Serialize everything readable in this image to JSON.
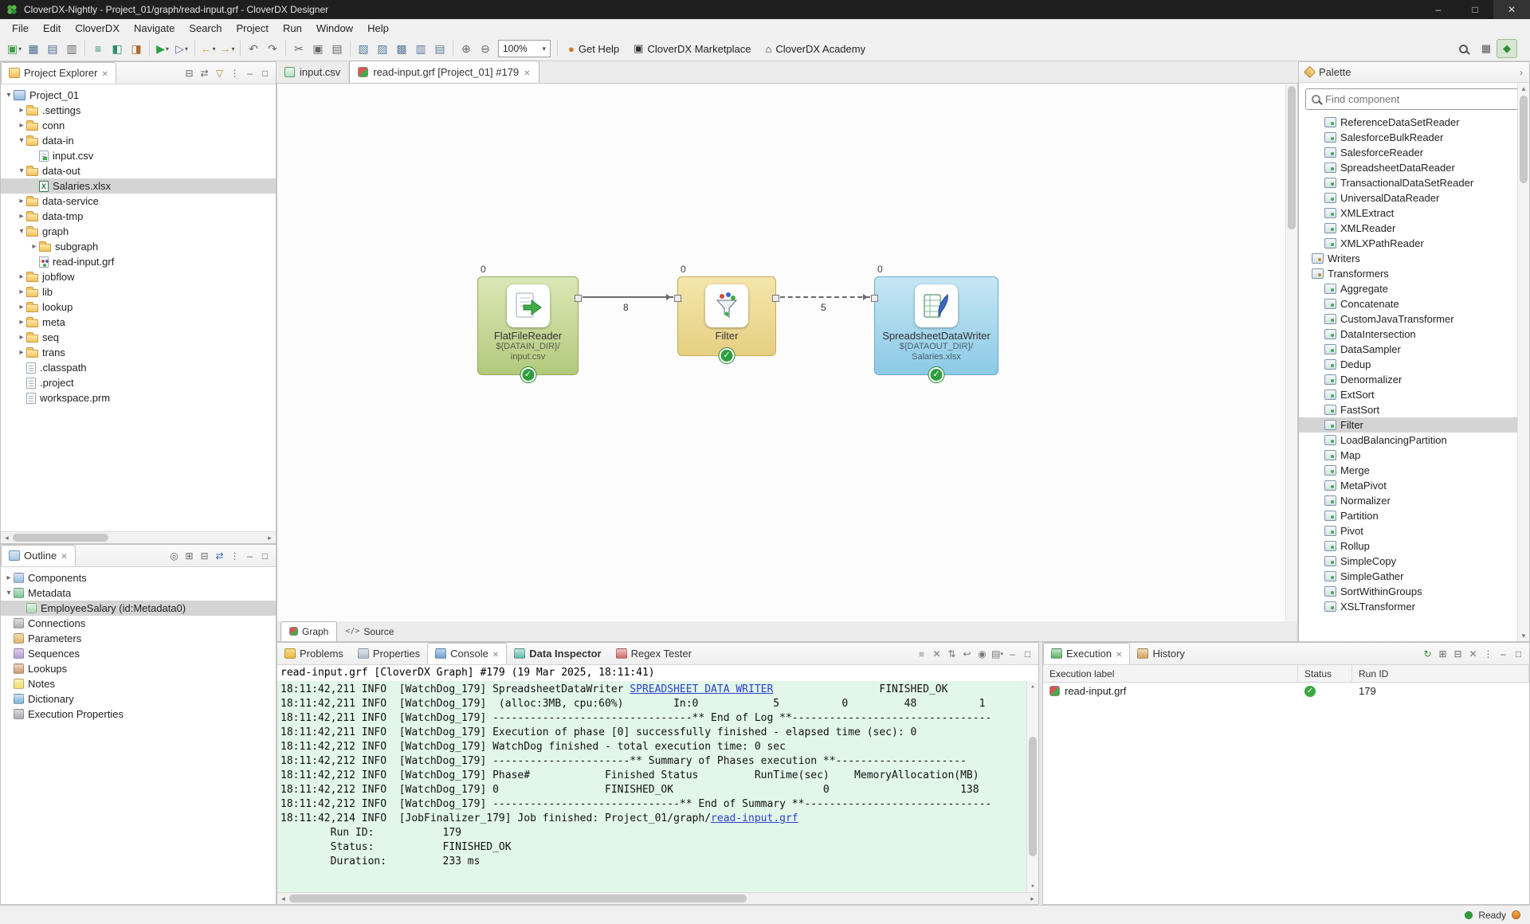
{
  "icons": {
    "close": "✕",
    "check": "✓",
    "win_min": "–",
    "win_max": "□",
    "win_close": "✕",
    "arrow_left": "◂",
    "arrow_right": "▸",
    "arrow_up": "▴",
    "arrow_down": "▾",
    "dropdown": "▾",
    "chevron_right": "›",
    "source": "</>"
  },
  "titlebar": {
    "title": "CloverDX-Nightly - Project_01/graph/read-input.grf - CloverDX Designer",
    "controls": [
      {
        "name": "minimize-window-button",
        "glyph": "–"
      },
      {
        "name": "maximize-window-button",
        "glyph": "□"
      },
      {
        "name": "close-window-button",
        "glyph": "✕"
      }
    ]
  },
  "menubar": {
    "items": [
      "File",
      "Edit",
      "CloverDX",
      "Navigate",
      "Search",
      "Project",
      "Run",
      "Window",
      "Help"
    ]
  },
  "toolbar": {
    "zoom_value": "100%",
    "icons": [
      {
        "name": "new-graph-button",
        "glyph": "▣",
        "color": "#3f9d4c",
        "dd": true
      },
      {
        "name": "save-button",
        "glyph": "▦",
        "color": "#4a6c8f"
      },
      {
        "name": "save-all-button",
        "glyph": "▤",
        "color": "#4a6c8f"
      },
      {
        "name": "print-button",
        "glyph": "▥",
        "color": "#666666"
      },
      {
        "sep": true
      },
      {
        "name": "metadata-button",
        "glyph": "≡",
        "color": "#2e8f6e"
      },
      {
        "name": "database-button",
        "glyph": "◧",
        "color": "#2e8f6e"
      },
      {
        "name": "connection-button",
        "glyph": "◨",
        "color": "#b06a2c"
      },
      {
        "sep": true
      },
      {
        "name": "run-graph-button",
        "glyph": "▶",
        "color": "#2ea043",
        "dd": true
      },
      {
        "name": "debug-graph-button",
        "glyph": "▷",
        "color": "#7a5ea8",
        "dd": true
      },
      {
        "sep": true
      },
      {
        "name": "back-button",
        "glyph": "←",
        "color": "#caa53d",
        "dd": true
      },
      {
        "name": "forward-button",
        "glyph": "→",
        "color": "#caa53d",
        "dd": true
      },
      {
        "sep": true
      },
      {
        "name": "undo-button",
        "glyph": "↶",
        "color": "#666666"
      },
      {
        "name": "redo-button",
        "glyph": "↷",
        "color": "#666666"
      },
      {
        "sep": true
      },
      {
        "name": "cut-button",
        "glyph": "✂",
        "color": "#666666"
      },
      {
        "name": "copy-button",
        "glyph": "▣",
        "color": "#666666"
      },
      {
        "name": "paste-button",
        "glyph": "▤",
        "color": "#666666"
      },
      {
        "sep": true
      },
      {
        "name": "align-left-button",
        "glyph": "▧",
        "color": "#5a7d9a"
      },
      {
        "name": "align-center-button",
        "glyph": "▨",
        "color": "#5a7d9a"
      },
      {
        "name": "align-right-button",
        "glyph": "▩",
        "color": "#5a7d9a"
      },
      {
        "name": "distribute-horizontal-button",
        "glyph": "▥",
        "color": "#5a7d9a"
      },
      {
        "name": "distribute-vertical-button",
        "glyph": "▤",
        "color": "#5a7d9a"
      },
      {
        "sep": true
      },
      {
        "name": "zoom-in-button",
        "glyph": "⊕",
        "color": "#666666"
      },
      {
        "name": "zoom-out-button",
        "glyph": "⊖",
        "color": "#666666"
      }
    ],
    "links": [
      {
        "name": "get-help-button",
        "label": "Get Help",
        "glyph": "●",
        "color": "#d9772a"
      },
      {
        "name": "marketplace-button",
        "label": "CloverDX Marketplace",
        "glyph": "▣",
        "color": "#333333"
      },
      {
        "name": "academy-button",
        "label": "CloverDX Academy",
        "glyph": "⌂",
        "color": "#333333"
      }
    ],
    "right_icons": [
      {
        "name": "open-perspective-icon",
        "glyph": "▦",
        "color": "#555555"
      },
      {
        "name": "cloverdx-perspective-icon",
        "glyph": "◆",
        "color": "#2e8f3a",
        "active": true
      }
    ]
  },
  "explorer": {
    "tab": "Project Explorer",
    "actions": [
      {
        "name": "collapse-all-icon",
        "glyph": "⊟",
        "color": "#666666"
      },
      {
        "name": "link-with-editor-icon",
        "glyph": "⇄",
        "color": "#666666"
      },
      {
        "name": "filter-tree-icon",
        "glyph": "▽",
        "color": "#a8862f"
      },
      {
        "name": "view-menu-icon",
        "glyph": "⋮",
        "color": "#666666"
      },
      {
        "name": "minimize-view-icon",
        "glyph": "–",
        "color": "#666666"
      },
      {
        "name": "maximize-view-icon",
        "glyph": "□",
        "color": "#666666"
      }
    ],
    "items": [
      {
        "label": "Project_01",
        "depth": 0,
        "icon": "project",
        "expander": "expanded"
      },
      {
        "label": ".settings",
        "depth": 1,
        "icon": "folder",
        "expander": "collapsed"
      },
      {
        "label": "conn",
        "depth": 1,
        "icon": "folder",
        "expander": "collapsed"
      },
      {
        "label": "data-in",
        "depth": 1,
        "icon": "folder",
        "expander": "expanded"
      },
      {
        "label": "input.csv",
        "depth": 2,
        "icon": "csv"
      },
      {
        "label": "data-out",
        "depth": 1,
        "icon": "folder",
        "expander": "expanded"
      },
      {
        "label": "Salaries.xlsx",
        "depth": 2,
        "icon": "excel",
        "selected": true
      },
      {
        "label": "data-service",
        "depth": 1,
        "icon": "folder",
        "expander": "collapsed"
      },
      {
        "label": "data-tmp",
        "depth": 1,
        "icon": "folder",
        "expander": "collapsed"
      },
      {
        "label": "graph",
        "depth": 1,
        "icon": "folder",
        "expander": "expanded"
      },
      {
        "label": "subgraph",
        "depth": 2,
        "icon": "folder",
        "expander": "collapsed"
      },
      {
        "label": "read-input.grf",
        "depth": 2,
        "icon": "graph"
      },
      {
        "label": "jobflow",
        "depth": 1,
        "icon": "folder",
        "expander": "collapsed"
      },
      {
        "label": "lib",
        "depth": 1,
        "icon": "folder",
        "expander": "collapsed"
      },
      {
        "label": "lookup",
        "depth": 1,
        "icon": "folder",
        "expander": "collapsed"
      },
      {
        "label": "meta",
        "depth": 1,
        "icon": "folder",
        "expander": "collapsed"
      },
      {
        "label": "seq",
        "depth": 1,
        "icon": "folder",
        "expander": "collapsed"
      },
      {
        "label": "trans",
        "depth": 1,
        "icon": "folder",
        "expander": "collapsed"
      },
      {
        "label": ".classpath",
        "depth": 1,
        "icon": "file"
      },
      {
        "label": ".project",
        "depth": 1,
        "icon": "file"
      },
      {
        "label": "workspace.prm",
        "depth": 1,
        "icon": "file"
      }
    ]
  },
  "outline": {
    "tab": "Outline",
    "actions": [
      {
        "name": "focus-icon",
        "glyph": "◎",
        "color": "#666666"
      },
      {
        "name": "expand-all-icon",
        "glyph": "⊞",
        "color": "#666666"
      },
      {
        "name": "collapse-all-icon",
        "glyph": "⊟",
        "color": "#666666"
      },
      {
        "name": "link-with-editor-icon",
        "glyph": "⇄",
        "color": "#2f6fb0"
      },
      {
        "name": "view-menu-icon",
        "glyph": "⋮",
        "color": "#666666"
      },
      {
        "name": "minimize-view-icon",
        "glyph": "–",
        "color": "#666666"
      },
      {
        "name": "maximize-view-icon",
        "glyph": "□",
        "color": "#666666"
      }
    ],
    "items": [
      {
        "label": "Components",
        "depth": 0,
        "icon": "components",
        "expander": "collapsed"
      },
      {
        "label": "Metadata",
        "depth": 0,
        "icon": "metadata",
        "expander": "expanded"
      },
      {
        "label": "EmployeeSalary (id:Metadata0)",
        "depth": 1,
        "icon": "record",
        "selected": true
      },
      {
        "label": "Connections",
        "depth": 0,
        "icon": "connections"
      },
      {
        "label": "Parameters",
        "depth": 0,
        "icon": "parameters"
      },
      {
        "label": "Sequences",
        "depth": 0,
        "icon": "sequences"
      },
      {
        "label": "Lookups",
        "depth": 0,
        "icon": "lookups"
      },
      {
        "label": "Notes",
        "depth": 0,
        "icon": "notes"
      },
      {
        "label": "Dictionary",
        "depth": 0,
        "icon": "dictionary"
      },
      {
        "label": "Execution Properties",
        "depth": 0,
        "icon": "execprops"
      }
    ]
  },
  "editor": {
    "tabs": [
      {
        "label": "input.csv"
      },
      {
        "label": "read-input.grf [Project_01] #179"
      }
    ],
    "bottom_tabs": [
      "Graph",
      "Source"
    ]
  },
  "canvas": {
    "nodes": [
      {
        "label": "FlatFileReader",
        "sub1": "${DATAIN_DIR}/",
        "sub2": "input.csv",
        "phase": "0"
      },
      {
        "label": "Filter",
        "sub1": "",
        "sub2": "",
        "phase": "0"
      },
      {
        "label": "SpreadsheetDataWriter",
        "sub1": "${DATAOUT_DIR}/",
        "sub2": "Salaries.xlsx",
        "phase": "0"
      }
    ],
    "edges": [
      {
        "count": "8"
      },
      {
        "count": "5"
      }
    ]
  },
  "palette": {
    "title": "Palette",
    "search_placeholder": "Find component",
    "items": [
      {
        "label": "ReferenceDataSetReader",
        "depth": 1,
        "type": "component"
      },
      {
        "label": "SalesforceBulkReader",
        "depth": 1,
        "type": "component"
      },
      {
        "label": "SalesforceReader",
        "depth": 1,
        "type": "component"
      },
      {
        "label": "SpreadsheetDataReader",
        "depth": 1,
        "type": "component"
      },
      {
        "label": "TransactionalDataSetReader",
        "depth": 1,
        "type": "component"
      },
      {
        "label": "UniversalDataReader",
        "depth": 1,
        "type": "component"
      },
      {
        "label": "XMLExtract",
        "depth": 1,
        "type": "component"
      },
      {
        "label": "XMLReader",
        "depth": 1,
        "type": "component"
      },
      {
        "label": "XMLXPathReader",
        "depth": 1,
        "type": "component"
      },
      {
        "label": "Writers",
        "depth": 0,
        "type": "category",
        "expander": "collapsed"
      },
      {
        "label": "Transformers",
        "depth": 0,
        "type": "category",
        "expander": "expanded"
      },
      {
        "label": "Aggregate",
        "depth": 1,
        "type": "component"
      },
      {
        "label": "Concatenate",
        "depth": 1,
        "type": "component"
      },
      {
        "label": "CustomJavaTransformer",
        "depth": 1,
        "type": "component"
      },
      {
        "label": "DataIntersection",
        "depth": 1,
        "type": "component"
      },
      {
        "label": "DataSampler",
        "depth": 1,
        "type": "component"
      },
      {
        "label": "Dedup",
        "depth": 1,
        "type": "component"
      },
      {
        "label": "Denormalizer",
        "depth": 1,
        "type": "component"
      },
      {
        "label": "ExtSort",
        "depth": 1,
        "type": "component"
      },
      {
        "label": "FastSort",
        "depth": 1,
        "type": "component"
      },
      {
        "label": "Filter",
        "depth": 1,
        "type": "component",
        "selected": true
      },
      {
        "label": "LoadBalancingPartition",
        "depth": 1,
        "type": "component"
      },
      {
        "label": "Map",
        "depth": 1,
        "type": "component"
      },
      {
        "label": "Merge",
        "depth": 1,
        "type": "component"
      },
      {
        "label": "MetaPivot",
        "depth": 1,
        "type": "component"
      },
      {
        "label": "Normalizer",
        "depth": 1,
        "type": "component"
      },
      {
        "label": "Partition",
        "depth": 1,
        "type": "component"
      },
      {
        "label": "Pivot",
        "depth": 1,
        "type": "component"
      },
      {
        "label": "Rollup",
        "depth": 1,
        "type": "component"
      },
      {
        "label": "SimpleCopy",
        "depth": 1,
        "type": "component"
      },
      {
        "label": "SimpleGather",
        "depth": 1,
        "type": "component"
      },
      {
        "label": "SortWithinGroups",
        "depth": 1,
        "type": "component"
      },
      {
        "label": "XSLTransformer",
        "depth": 1,
        "type": "component"
      }
    ]
  },
  "console": {
    "tabs": [
      {
        "name": "tab-problems",
        "label": "Problems",
        "icon": "problems"
      },
      {
        "name": "tab-properties",
        "label": "Properties",
        "icon": "properties"
      },
      {
        "name": "tab-console",
        "label": "Console",
        "icon": "console",
        "active": true,
        "closable": true
      },
      {
        "name": "tab-data-inspector",
        "label": "Data Inspector",
        "icon": "inspector",
        "bold": true
      },
      {
        "name": "tab-regex-tester",
        "label": "Regex Tester",
        "icon": "regex"
      }
    ],
    "toolbar": [
      {
        "name": "terminate-icon",
        "glyph": "■",
        "color": "#c0c0c0"
      },
      {
        "name": "clear-console-icon",
        "glyph": "✕",
        "color": "#777777"
      },
      {
        "name": "scroll-lock-icon",
        "glyph": "⇅",
        "color": "#777777"
      },
      {
        "name": "word-wrap-icon",
        "glyph": "↩",
        "color": "#777777"
      },
      {
        "name": "pin-console-icon",
        "glyph": "◉",
        "color": "#777777"
      },
      {
        "name": "display-console-icon",
        "glyph": "▤",
        "color": "#777777",
        "dd": true
      },
      {
        "name": "minimize-view-icon",
        "glyph": "–",
        "color": "#666666"
      },
      {
        "name": "maximize-view-icon",
        "glyph": "□",
        "color": "#666666"
      }
    ],
    "header": "read-input.grf [CloverDX Graph] #179 (19 Mar 2025, 18:11:41)",
    "lines": [
      {
        "segments": [
          {
            "text": "18:11:42,211 INFO  [WatchDog_179] SpreadsheetDataWriter "
          },
          {
            "text": "SPREADSHEET DATA WRITER",
            "link": true
          },
          {
            "text": "                 FINISHED_OK"
          }
        ]
      },
      {
        "segments": [
          {
            "text": "18:11:42,211 INFO  [WatchDog_179]  (alloc:3MB, cpu:60%)        In:0            5          0         48          1"
          }
        ]
      },
      {
        "segments": [
          {
            "text": "18:11:42,211 INFO  [WatchDog_179] --------------------------------** End of Log **--------------------------------"
          }
        ]
      },
      {
        "segments": [
          {
            "text": "18:11:42,211 INFO  [WatchDog_179] Execution of phase [0] successfully finished - elapsed time (sec): 0"
          }
        ]
      },
      {
        "segments": [
          {
            "text": "18:11:42,212 INFO  [WatchDog_179] WatchDog finished - total execution time: 0 sec"
          }
        ]
      },
      {
        "segments": [
          {
            "text": "18:11:42,212 INFO  [WatchDog_179] ----------------------** Summary of Phases execution **---------------------"
          }
        ]
      },
      {
        "segments": [
          {
            "text": "18:11:42,212 INFO  [WatchDog_179] Phase#            Finished Status         RunTime(sec)    MemoryAllocation(MB)"
          }
        ]
      },
      {
        "segments": [
          {
            "text": "18:11:42,212 INFO  [WatchDog_179] 0                 FINISHED_OK                        0                     138"
          }
        ]
      },
      {
        "segments": [
          {
            "text": "18:11:42,212 INFO  [WatchDog_179] ------------------------------** End of Summary **------------------------------"
          }
        ]
      },
      {
        "segments": [
          {
            "text": "18:11:42,214 INFO  [JobFinalizer_179] Job finished: Project_01/graph/"
          },
          {
            "text": "read-input.grf",
            "link": true
          }
        ]
      },
      {
        "segments": [
          {
            "text": "        Run ID:           179"
          }
        ]
      },
      {
        "segments": [
          {
            "text": "        Status:           FINISHED_OK"
          }
        ]
      },
      {
        "segments": [
          {
            "text": "        Duration:         233 ms"
          }
        ]
      }
    ]
  },
  "execution": {
    "tabs": [
      {
        "name": "tab-execution",
        "label": "Execution",
        "icon": "execution",
        "active": true,
        "closable": true
      },
      {
        "name": "tab-history",
        "label": "History",
        "icon": "history"
      }
    ],
    "toolbar": [
      {
        "name": "refresh-icon",
        "glyph": "↻",
        "color": "#2e8f3a"
      },
      {
        "name": "expand-all-icon",
        "glyph": "⊞",
        "color": "#666666"
      },
      {
        "name": "collapse-all-icon",
        "glyph": "⊟",
        "color": "#666666"
      },
      {
        "name": "clear-icon",
        "glyph": "✕",
        "color": "#777777"
      },
      {
        "name": "view-menu-icon",
        "glyph": "⋮",
        "color": "#666666"
      },
      {
        "name": "minimize-view-icon",
        "glyph": "–",
        "color": "#666666"
      },
      {
        "name": "maximize-view-icon",
        "glyph": "□",
        "color": "#666666"
      }
    ],
    "columns": [
      "Execution label",
      "Status",
      "Run ID"
    ],
    "rows": [
      {
        "label": "read-input.grf",
        "run_id": "179"
      }
    ]
  },
  "statusbar": {
    "ready_label": "Ready"
  }
}
